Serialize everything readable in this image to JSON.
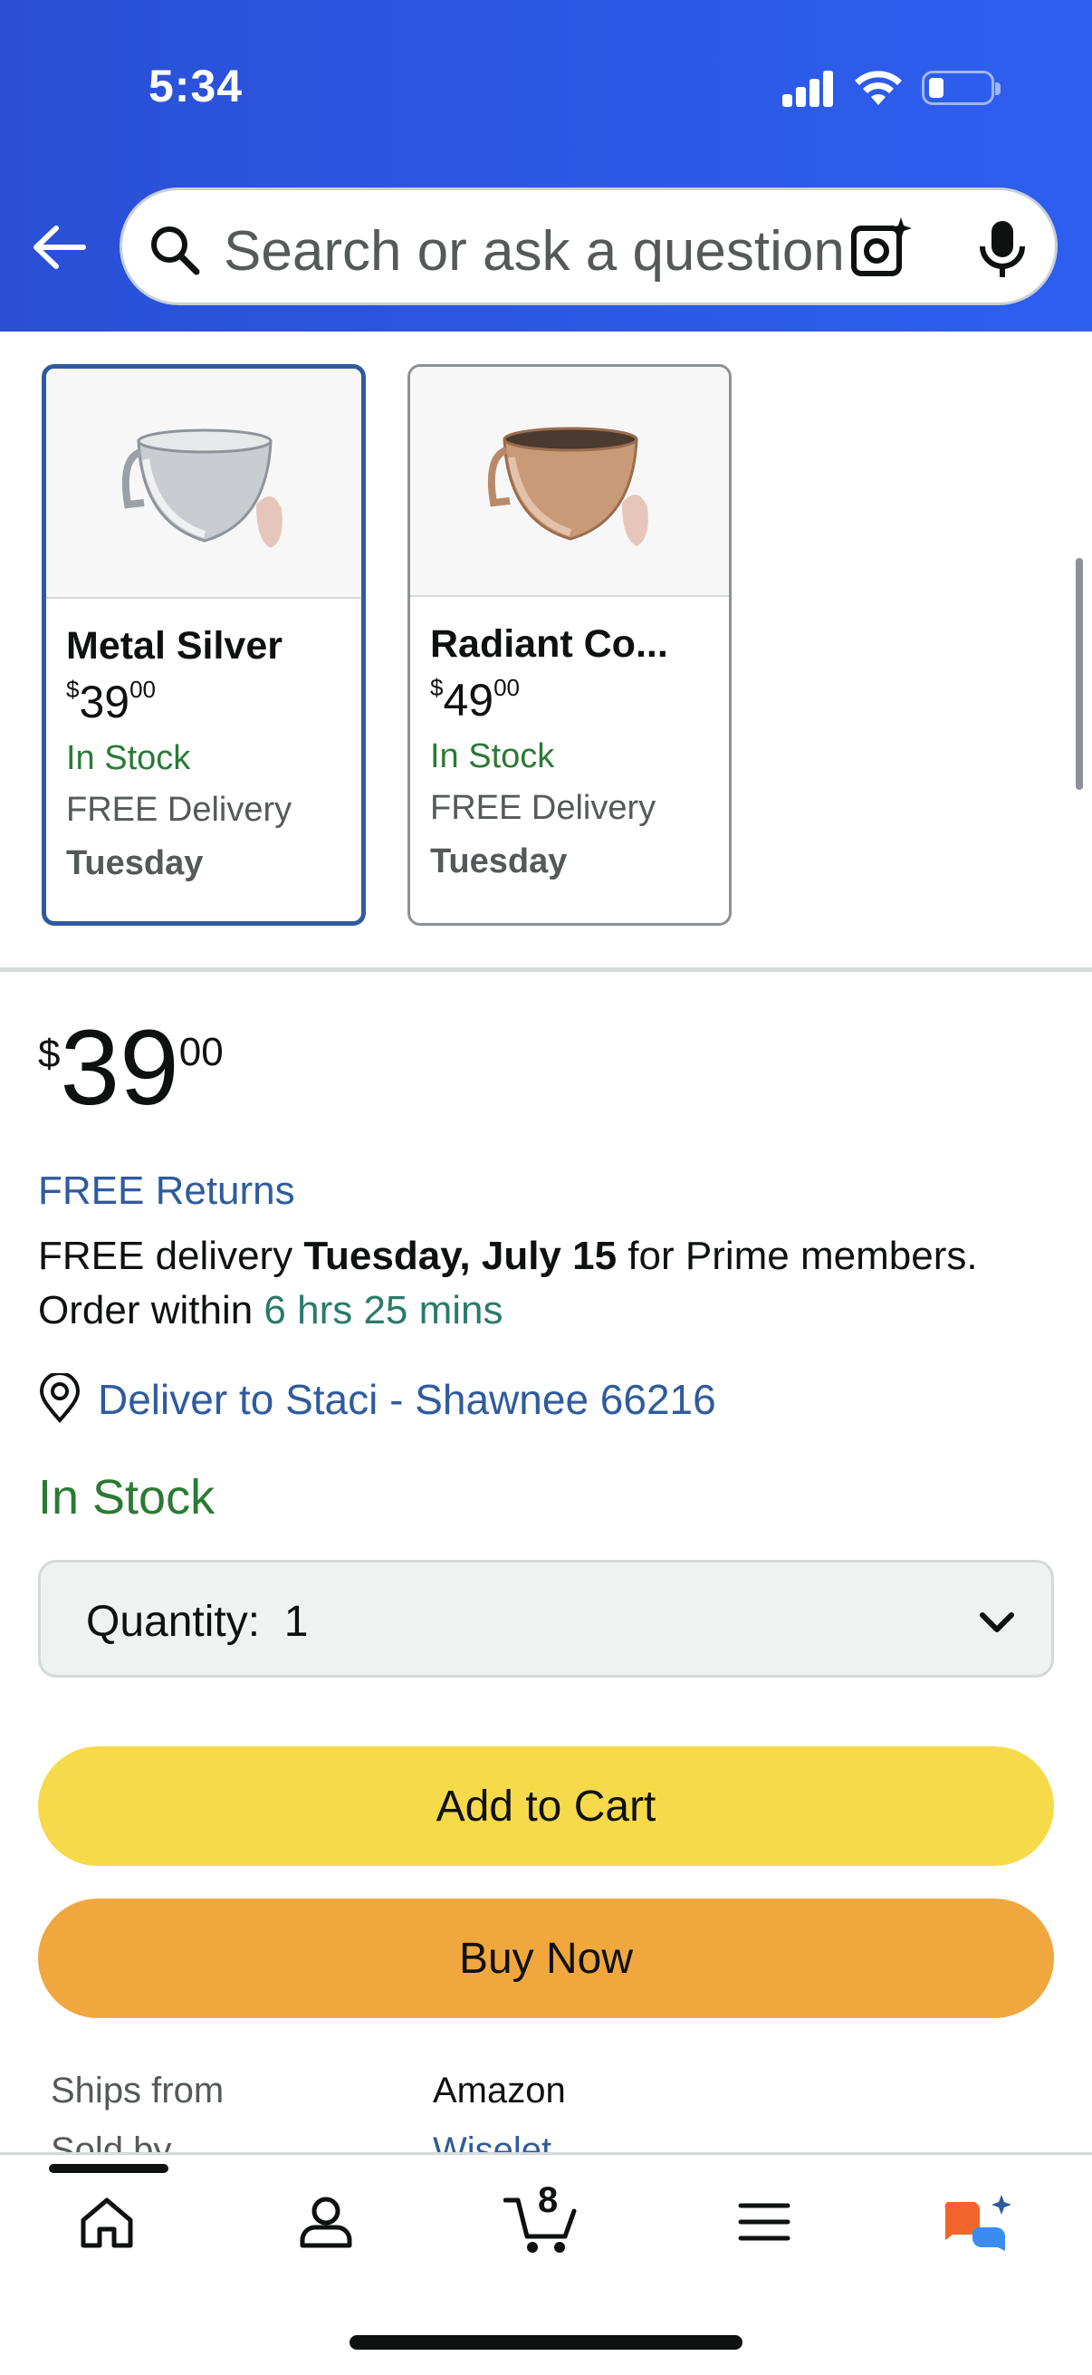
{
  "status_bar": {
    "time": "5:34"
  },
  "search": {
    "placeholder": "Search or ask a question"
  },
  "variants": [
    {
      "name": "Metal Silver",
      "currency": "$",
      "price_whole": "39",
      "price_fraction": "00",
      "stock": "In Stock",
      "delivery": "FREE Delivery",
      "delivery_day": "Tuesday",
      "selected": true
    },
    {
      "name": "Radiant Co...",
      "currency": "$",
      "price_whole": "49",
      "price_fraction": "00",
      "stock": "In Stock",
      "delivery": "FREE Delivery",
      "delivery_day": "Tuesday",
      "selected": false
    }
  ],
  "price": {
    "currency": "$",
    "whole": "39",
    "fraction": "00"
  },
  "returns": "FREE Returns",
  "delivery": {
    "prefix": "FREE delivery ",
    "date": "Tuesday, July 15",
    "suffix": " for Prime members.",
    "order_within_label": "Order within ",
    "countdown": "6 hrs 25 mins"
  },
  "deliver_to": "Deliver to Staci - Shawnee 66216",
  "stock_status": "In Stock",
  "quantity": {
    "label": "Quantity:",
    "value": "1"
  },
  "buttons": {
    "add_to_cart": "Add to Cart",
    "buy_now": "Buy Now"
  },
  "seller_info": {
    "ships_from_label": "Ships from",
    "ships_from_value": "Amazon",
    "sold_by_label": "Sold by",
    "sold_by_value": "Wiselet"
  },
  "bottom_nav": {
    "cart_count": "8"
  },
  "colors": {
    "header_blue": "#2e5ff0",
    "add_to_cart": "#f7da4a",
    "buy_now": "#f0a73e",
    "link_blue": "#2f5b9e",
    "stock_green": "#2a7a34"
  }
}
